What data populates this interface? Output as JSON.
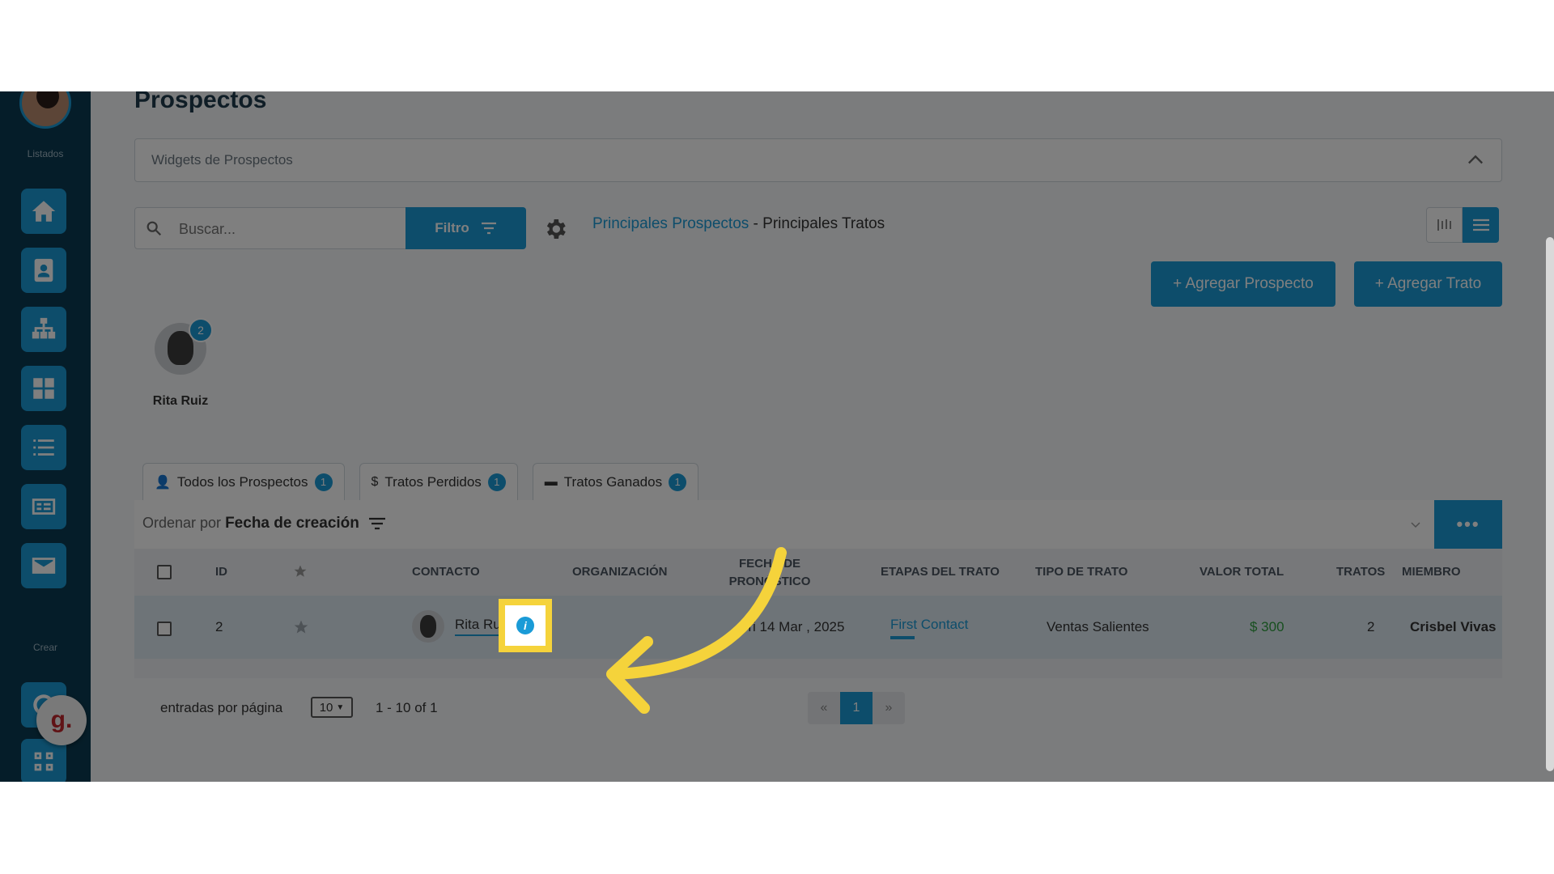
{
  "sidebar": {
    "section_list": "Listados",
    "section_create": "Crear",
    "icons": [
      "home-icon",
      "contact-card-icon",
      "org-chart-icon",
      "grid-icon",
      "list-icon",
      "invoice-icon",
      "mail-icon"
    ],
    "brand_badge": "g."
  },
  "page": {
    "title": "Prospectos"
  },
  "widgets": {
    "label": "Widgets de Prospectos"
  },
  "search": {
    "placeholder": "Buscar..."
  },
  "filter": {
    "label": "Filtro"
  },
  "breadcrumb": {
    "link": "Principales Prospectos",
    "separator": " - ",
    "current": "Principales Tratos"
  },
  "actions": {
    "add_prospect": "+ Agregar Prospecto",
    "add_deal": "+ Agregar Trato"
  },
  "member_card": {
    "name": "Rita Ruiz",
    "count": "2"
  },
  "tabs": [
    {
      "icon": "👤",
      "label": "Todos los Prospectos",
      "count": "1"
    },
    {
      "icon": "$",
      "label": "Tratos Perdidos",
      "count": "1"
    },
    {
      "icon": "▬",
      "label": "Tratos Ganados",
      "count": "1"
    }
  ],
  "sort": {
    "prefix": "Ordenar por",
    "field": "Fecha de creación"
  },
  "table": {
    "headers": {
      "id": "ID",
      "contact": "CONTACTO",
      "org": "ORGANIZACIÓN",
      "forecast_line1": "FECHA DE",
      "forecast_line2": "PRONÓSTICO",
      "stage": "ETAPAS DEL TRATO",
      "type": "TIPO DE TRATO",
      "value": "VALOR TOTAL",
      "deals": "TRATOS",
      "member": "MIEMBRO"
    },
    "rows": [
      {
        "id": "2",
        "contact": "Rita Ruiz",
        "org": "",
        "forecast": "Fri 14 Mar , 2025",
        "stage": "First Contact",
        "type": "Ventas Salientes",
        "value": "$ 300",
        "deals": "2",
        "member": "Crisbel Vivas"
      }
    ]
  },
  "pagination": {
    "per_page_label": "entradas por página",
    "per_page_value": "10",
    "range": "1 - 10 of 1",
    "prev": "«",
    "current": "1",
    "next": "»"
  },
  "colors": {
    "accent": "#1a9bd7",
    "highlight": "#f5d33b",
    "sidebar": "#0b3b52",
    "money": "#2e9e3e"
  }
}
